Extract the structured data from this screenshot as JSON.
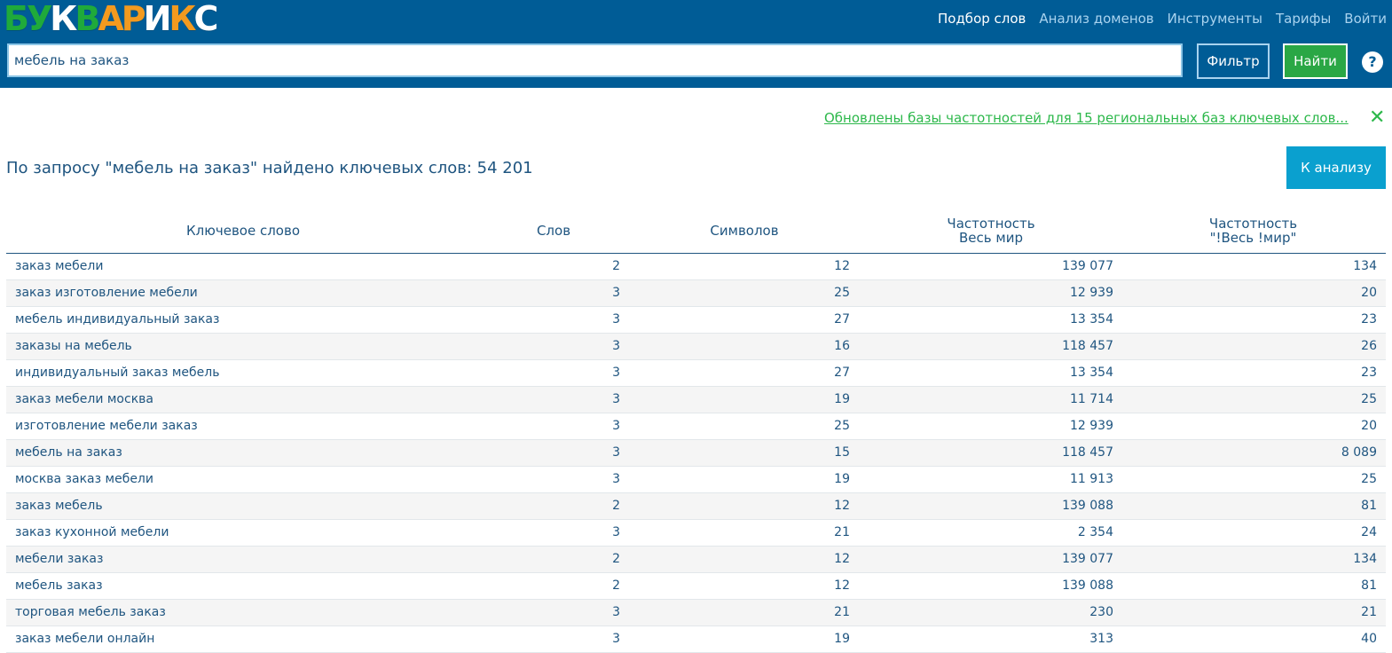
{
  "logo": {
    "letters": [
      {
        "ch": "Б",
        "color": "#1faa3b"
      },
      {
        "ch": "У",
        "color": "#1faa3b"
      },
      {
        "ch": "К",
        "color": "#ffffff"
      },
      {
        "ch": "В",
        "color": "#1faa3b"
      },
      {
        "ch": "А",
        "color": "#f39a1f"
      },
      {
        "ch": "Р",
        "color": "#f39a1f"
      },
      {
        "ch": "И",
        "color": "#ffffff"
      },
      {
        "ch": "К",
        "color": "#f39a1f"
      },
      {
        "ch": "С",
        "color": "#ffffff"
      }
    ]
  },
  "nav": {
    "items": [
      "Подбор слов",
      "Анализ доменов",
      "Инструменты",
      "Тарифы",
      "Войти"
    ],
    "active_index": 0
  },
  "search": {
    "value": "мебель на заказ"
  },
  "buttons": {
    "filter": "Фильтр",
    "find": "Найти",
    "help": "?",
    "analysis": "К анализу"
  },
  "notice": {
    "text": "Обновлены базы частотностей для 15 региональных баз ключевых слов...",
    "close": "✕"
  },
  "result": {
    "title": "По запросу \"мебель на заказ\" найдено ключевых слов: 54 201"
  },
  "table": {
    "headers": {
      "keyword": "Ключевое слово",
      "words": "Слов",
      "chars": "Символов",
      "freq_world_1": "Частотность",
      "freq_world_2": "Весь мир",
      "freq_exact_1": "Частотность",
      "freq_exact_2": "\"!Весь !мир\""
    },
    "rows": [
      [
        "заказ мебели",
        "2",
        "12",
        "139 077",
        "134"
      ],
      [
        "заказ изготовление мебели",
        "3",
        "25",
        "12 939",
        "20"
      ],
      [
        "мебель индивидуальный заказ",
        "3",
        "27",
        "13 354",
        "23"
      ],
      [
        "заказы на мебель",
        "3",
        "16",
        "118 457",
        "26"
      ],
      [
        "индивидуальный заказ мебель",
        "3",
        "27",
        "13 354",
        "23"
      ],
      [
        "заказ мебели москва",
        "3",
        "19",
        "11 714",
        "25"
      ],
      [
        "изготовление мебели заказ",
        "3",
        "25",
        "12 939",
        "20"
      ],
      [
        "мебель на заказ",
        "3",
        "15",
        "118 457",
        "8 089"
      ],
      [
        "москва заказ мебели",
        "3",
        "19",
        "11 913",
        "25"
      ],
      [
        "заказ мебель",
        "2",
        "12",
        "139 088",
        "81"
      ],
      [
        "заказ кухонной мебели",
        "3",
        "21",
        "2 354",
        "24"
      ],
      [
        "мебели заказ",
        "2",
        "12",
        "139 077",
        "134"
      ],
      [
        "мебель заказ",
        "2",
        "12",
        "139 088",
        "81"
      ],
      [
        "торговая мебель заказ",
        "3",
        "21",
        "230",
        "21"
      ],
      [
        "заказ мебели онлайн",
        "3",
        "19",
        "313",
        "40"
      ]
    ]
  }
}
